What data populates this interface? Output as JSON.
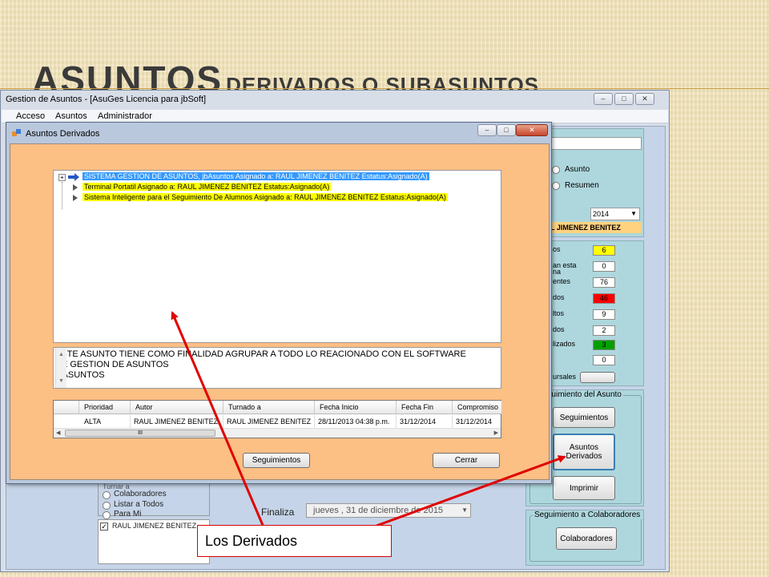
{
  "slide": {
    "title_big": "ASUNTOS",
    "title_small": "DERIVADOS O SUBASUNTOS"
  },
  "main_window": {
    "title": "Gestion de Asuntos - [AsuGes   Licencia para jbSoft]",
    "menu": [
      "Acceso",
      "Asuntos",
      "Administrador"
    ],
    "view_options": [
      "Asunto",
      "Resumen"
    ],
    "year": "2014",
    "user_banner": "L JIMENEZ BENITEZ",
    "counters": [
      {
        "label": "os",
        "value": "6",
        "color": "#ffff00"
      },
      {
        "label": "an esta",
        "value": "0",
        "color": "#ffffff"
      },
      {
        "label": "entes",
        "value": "76",
        "color": "#ffffff"
      },
      {
        "label": "dos",
        "value": "46",
        "color": "#ff0000"
      },
      {
        "label": "ltos",
        "value": "9",
        "color": "#ffffff"
      },
      {
        "label": "dos",
        "value": "2",
        "color": "#ffffff"
      },
      {
        "label": "lizados",
        "value": "3",
        "color": "#00a000"
      },
      {
        "label": "",
        "value": "0",
        "color": "#ffffff"
      }
    ],
    "extra_label_na": "na",
    "sucursales_label": "ursales",
    "seguimiento_group": "guimiento del Asunto",
    "btn_seguimientos": "Seguimientos",
    "btn_asuntos_derivados_1": "Asuntos",
    "btn_asuntos_derivados_2": "Derivados",
    "btn_imprimir": "Imprimir",
    "colab_group": "Seguimiento a Colaboradores",
    "btn_colaboradores": "Colaboradores",
    "turnar_label": "Turnar a",
    "turnar_options": [
      "Colaboradores",
      "Listar a Todos",
      "Para Mi"
    ],
    "checked_user": "RAUL JIMENEZ BENITEZ",
    "finaliza_label": "Finaliza",
    "finaliza_date": "jueves  ,  31 de  diciembre  de 2015"
  },
  "dialog": {
    "title": "Asuntos Derivados",
    "tree": [
      "SISTEMA GESTION DE ASUNTOS, jbAsuntos Asignado a: RAUL JIMENEZ BENITEZ Estatus:Asignado(A)",
      "Terminal Portatil Asignado a: RAUL JIMENEZ BENITEZ Estatus:Asignado(A)",
      "Sistema Inteligente para el Seguimiento De Alumnos Asignado a: RAUL JIMENEZ BENITEZ Estatus:Asignado(A)"
    ],
    "description": [
      "ESTE ASUNTO TIENE COMO FINALIDAD AGRUPAR A TODO LO REACIONADO CON EL SOFTWARE",
      "DE GESTION DE ASUNTOS",
      "jbASUNTOS"
    ],
    "grid_headers": [
      "Prioridad",
      "Autor",
      "Turnado a",
      "Fecha Inicio",
      "Fecha Fin",
      "Compromiso"
    ],
    "grid_row": [
      "ALTA",
      "RAUL JIMENEZ BENITEZ",
      "RAUL JIMENEZ BENITEZ",
      "28/11/2013 04:38 p.m.",
      "31/12/2014",
      "31/12/2014"
    ],
    "scroll_marker": "III",
    "btn_seguimientos": "Seguimientos",
    "btn_cerrar": "Cerrar"
  },
  "annotation": {
    "text": "Los Derivados",
    "color": "#e00000"
  }
}
